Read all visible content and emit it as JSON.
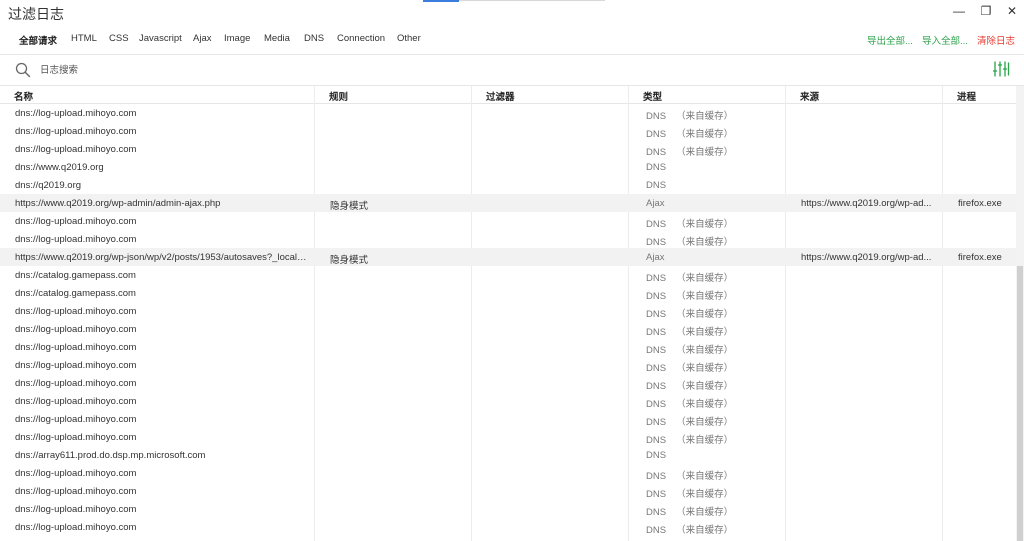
{
  "window": {
    "title": "过滤日志",
    "min_glyph": "—",
    "restore_glyph": "❐",
    "close_glyph": "✕"
  },
  "tabs": [
    {
      "label": "全部请求",
      "active": true
    },
    {
      "label": "HTML"
    },
    {
      "label": "CSS"
    },
    {
      "label": "Javascript"
    },
    {
      "label": "Ajax"
    },
    {
      "label": "Image"
    },
    {
      "label": "Media"
    },
    {
      "label": "DNS"
    },
    {
      "label": "Connection"
    },
    {
      "label": "Other"
    }
  ],
  "actions": {
    "export_all": "导出全部...",
    "import_all": "导入全部...",
    "clear_log": "清除日志"
  },
  "search": {
    "placeholder": "日志搜索",
    "value": ""
  },
  "columns": {
    "name": "名称",
    "rule": "规则",
    "filter": "过滤器",
    "type": "类型",
    "source": "来源",
    "process": "进程"
  },
  "colors": {
    "green_action": "#2aa34a",
    "red_action": "#e43a2f",
    "highlight_row": "#f2f2f2",
    "filter_icon": "#2aa34a"
  },
  "rows": [
    {
      "name": "dns://log-upload.mihoyo.com",
      "rule": "",
      "filter": "",
      "type": "DNS",
      "cache": "（来自缓存）",
      "source": "",
      "process": ""
    },
    {
      "name": "dns://log-upload.mihoyo.com",
      "rule": "",
      "filter": "",
      "type": "DNS",
      "cache": "（来自缓存）",
      "source": "",
      "process": ""
    },
    {
      "name": "dns://log-upload.mihoyo.com",
      "rule": "",
      "filter": "",
      "type": "DNS",
      "cache": "（来自缓存）",
      "source": "",
      "process": ""
    },
    {
      "name": "dns://www.q2019.org",
      "rule": "",
      "filter": "",
      "type": "DNS",
      "cache": "",
      "source": "",
      "process": ""
    },
    {
      "name": "dns://q2019.org",
      "rule": "",
      "filter": "",
      "type": "DNS",
      "cache": "",
      "source": "",
      "process": ""
    },
    {
      "name": "https://www.q2019.org/wp-admin/admin-ajax.php",
      "rule": "隐身模式",
      "filter": "",
      "type": "Ajax",
      "cache": "",
      "source": "https://www.q2019.org/wp-ad...",
      "process": "firefox.exe",
      "highlight": true
    },
    {
      "name": "dns://log-upload.mihoyo.com",
      "rule": "",
      "filter": "",
      "type": "DNS",
      "cache": "（来自缓存）",
      "source": "",
      "process": ""
    },
    {
      "name": "dns://log-upload.mihoyo.com",
      "rule": "",
      "filter": "",
      "type": "DNS",
      "cache": "（来自缓存）",
      "source": "",
      "process": ""
    },
    {
      "name": "https://www.q2019.org/wp-json/wp/v2/posts/1953/autosaves?_locale=...",
      "rule": "隐身模式",
      "filter": "",
      "type": "Ajax",
      "cache": "",
      "source": "https://www.q2019.org/wp-ad...",
      "process": "firefox.exe",
      "highlight": true
    },
    {
      "name": "dns://catalog.gamepass.com",
      "rule": "",
      "filter": "",
      "type": "DNS",
      "cache": "（来自缓存）",
      "source": "",
      "process": ""
    },
    {
      "name": "dns://catalog.gamepass.com",
      "rule": "",
      "filter": "",
      "type": "DNS",
      "cache": "（来自缓存）",
      "source": "",
      "process": ""
    },
    {
      "name": "dns://log-upload.mihoyo.com",
      "rule": "",
      "filter": "",
      "type": "DNS",
      "cache": "（来自缓存）",
      "source": "",
      "process": ""
    },
    {
      "name": "dns://log-upload.mihoyo.com",
      "rule": "",
      "filter": "",
      "type": "DNS",
      "cache": "（来自缓存）",
      "source": "",
      "process": ""
    },
    {
      "name": "dns://log-upload.mihoyo.com",
      "rule": "",
      "filter": "",
      "type": "DNS",
      "cache": "（来自缓存）",
      "source": "",
      "process": ""
    },
    {
      "name": "dns://log-upload.mihoyo.com",
      "rule": "",
      "filter": "",
      "type": "DNS",
      "cache": "（来自缓存）",
      "source": "",
      "process": ""
    },
    {
      "name": "dns://log-upload.mihoyo.com",
      "rule": "",
      "filter": "",
      "type": "DNS",
      "cache": "（来自缓存）",
      "source": "",
      "process": ""
    },
    {
      "name": "dns://log-upload.mihoyo.com",
      "rule": "",
      "filter": "",
      "type": "DNS",
      "cache": "（来自缓存）",
      "source": "",
      "process": ""
    },
    {
      "name": "dns://log-upload.mihoyo.com",
      "rule": "",
      "filter": "",
      "type": "DNS",
      "cache": "（来自缓存）",
      "source": "",
      "process": ""
    },
    {
      "name": "dns://log-upload.mihoyo.com",
      "rule": "",
      "filter": "",
      "type": "DNS",
      "cache": "（来自缓存）",
      "source": "",
      "process": ""
    },
    {
      "name": "dns://array611.prod.do.dsp.mp.microsoft.com",
      "rule": "",
      "filter": "",
      "type": "DNS",
      "cache": "",
      "source": "",
      "process": ""
    },
    {
      "name": "dns://log-upload.mihoyo.com",
      "rule": "",
      "filter": "",
      "type": "DNS",
      "cache": "（来自缓存）",
      "source": "",
      "process": ""
    },
    {
      "name": "dns://log-upload.mihoyo.com",
      "rule": "",
      "filter": "",
      "type": "DNS",
      "cache": "（来自缓存）",
      "source": "",
      "process": ""
    },
    {
      "name": "dns://log-upload.mihoyo.com",
      "rule": "",
      "filter": "",
      "type": "DNS",
      "cache": "（来自缓存）",
      "source": "",
      "process": ""
    },
    {
      "name": "dns://log-upload.mihoyo.com",
      "rule": "",
      "filter": "",
      "type": "DNS",
      "cache": "（来自缓存）",
      "source": "",
      "process": ""
    }
  ]
}
